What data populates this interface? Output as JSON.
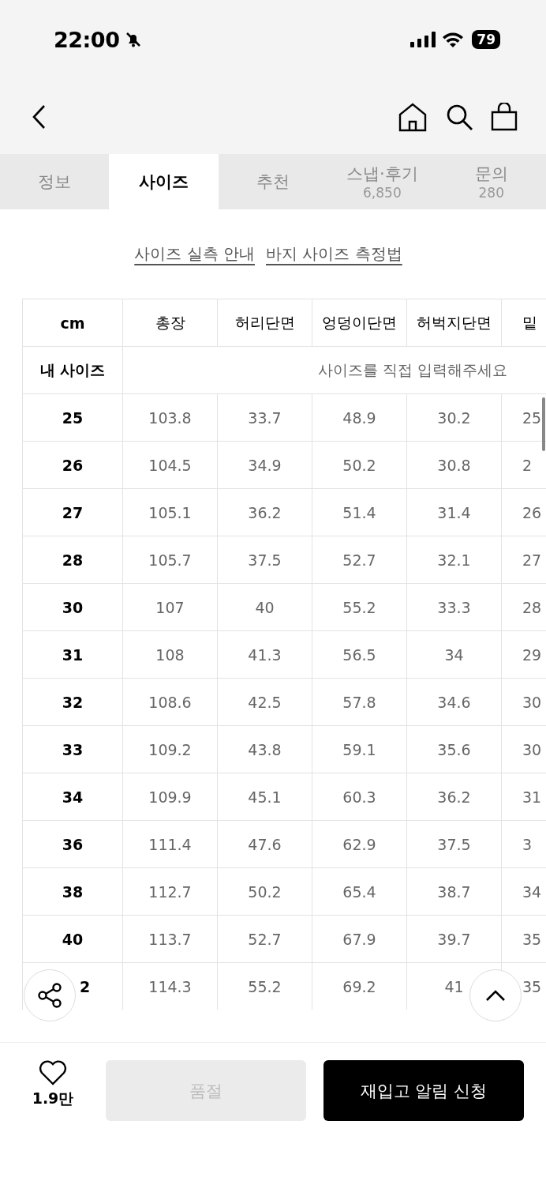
{
  "status_bar": {
    "time": "22:00",
    "battery": "79"
  },
  "tabs": [
    {
      "label": "정보",
      "selected": false
    },
    {
      "label": "사이즈",
      "selected": true
    },
    {
      "label": "추천",
      "selected": false
    },
    {
      "label": "스냅·후기",
      "count": "6,850",
      "selected": false
    },
    {
      "label": "문의",
      "count": "280",
      "selected": false
    }
  ],
  "links": [
    "사이즈 실측 안내",
    "바지 사이즈 측정법"
  ],
  "size_table": {
    "columns": [
      "cm",
      "총장",
      "허리단면",
      "엉덩이단면",
      "허벅지단면",
      "밑"
    ],
    "my_size": {
      "label": "내 사이즈",
      "placeholder": "사이즈를 직접 입력해주세요"
    },
    "rows": [
      [
        "25",
        "103.8",
        "33.7",
        "48.9",
        "30.2",
        "25"
      ],
      [
        "26",
        "104.5",
        "34.9",
        "50.2",
        "30.8",
        "2"
      ],
      [
        "27",
        "105.1",
        "36.2",
        "51.4",
        "31.4",
        "26"
      ],
      [
        "28",
        "105.7",
        "37.5",
        "52.7",
        "32.1",
        "27"
      ],
      [
        "30",
        "107",
        "40",
        "55.2",
        "33.3",
        "28"
      ],
      [
        "31",
        "108",
        "41.3",
        "56.5",
        "34",
        "29"
      ],
      [
        "32",
        "108.6",
        "42.5",
        "57.8",
        "34.6",
        "30"
      ],
      [
        "33",
        "109.2",
        "43.8",
        "59.1",
        "35.6",
        "30"
      ],
      [
        "34",
        "109.9",
        "45.1",
        "60.3",
        "36.2",
        "31"
      ],
      [
        "36",
        "111.4",
        "47.6",
        "62.9",
        "37.5",
        "3"
      ],
      [
        "38",
        "112.7",
        "50.2",
        "65.4",
        "38.7",
        "34"
      ],
      [
        "40",
        "113.7",
        "52.7",
        "67.9",
        "39.7",
        "35"
      ],
      [
        "2",
        "114.3",
        "55.2",
        "69.2",
        "41",
        "35"
      ]
    ]
  },
  "bottom_bar": {
    "like_count": "1.9만",
    "sold_out": {
      "label": "품절",
      "disabled": true
    },
    "restock": "재입고 알림 신청"
  }
}
